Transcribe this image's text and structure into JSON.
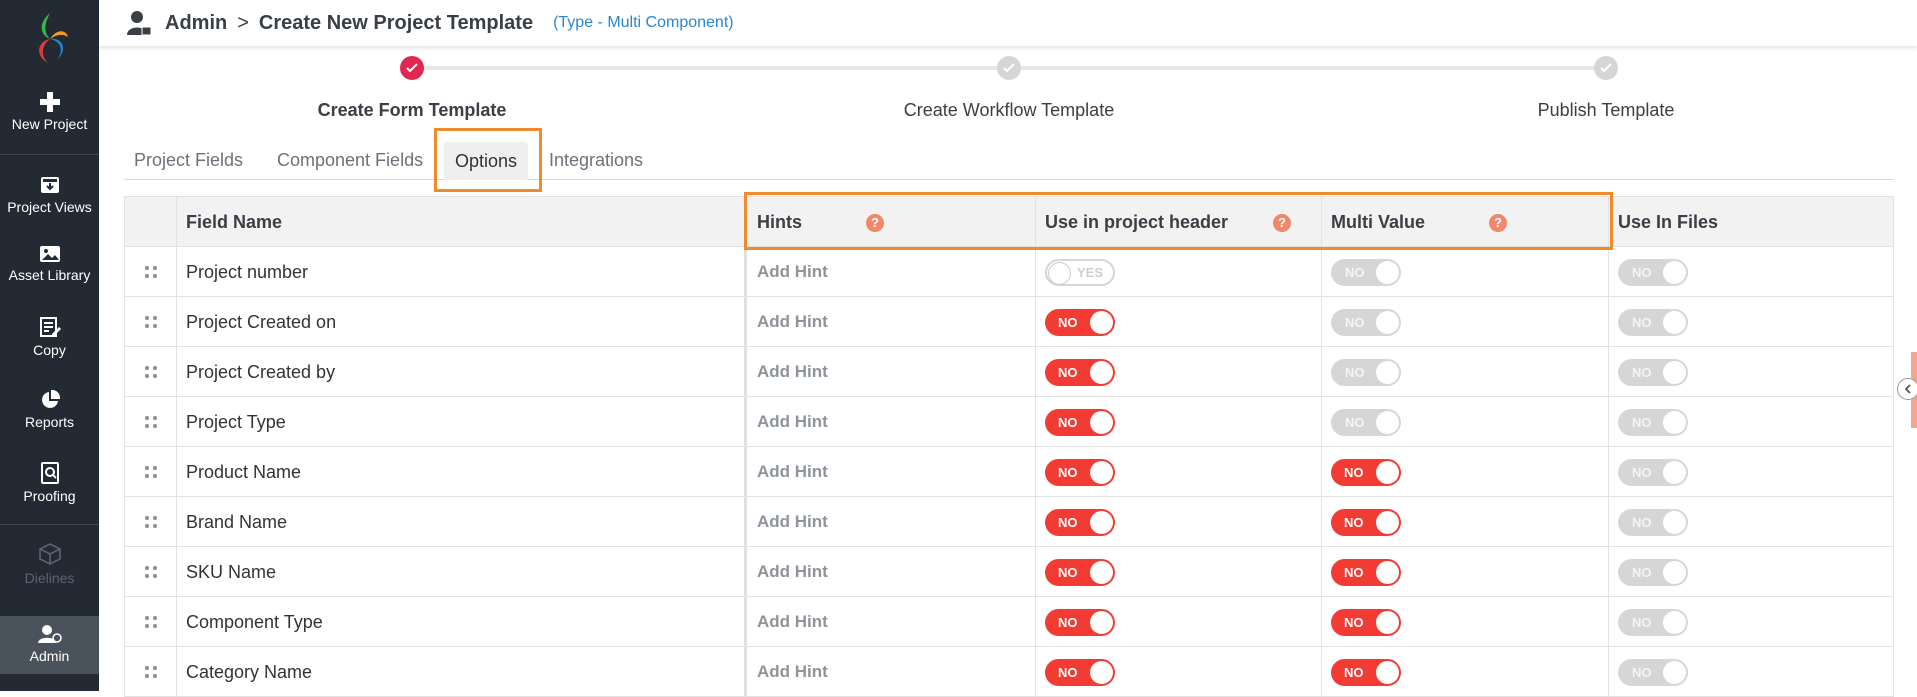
{
  "sidebar": {
    "items": [
      {
        "label": "New Project",
        "icon": "plus-icon"
      },
      {
        "label": "Project Views",
        "icon": "project-views-icon"
      },
      {
        "label": "Asset Library",
        "icon": "image-icon"
      },
      {
        "label": "Copy",
        "icon": "edit-icon"
      },
      {
        "label": "Reports",
        "icon": "pie-chart-icon"
      },
      {
        "label": "Proofing",
        "icon": "proofing-icon"
      },
      {
        "label": "Dielines",
        "icon": "box-icon"
      },
      {
        "label": "Admin",
        "icon": "admin-user-icon"
      }
    ]
  },
  "header": {
    "breadcrumb_root": "Admin",
    "separator": ">",
    "page_title": "Create New Project Template",
    "subtitle": "(Type - Multi Component)"
  },
  "stepper": {
    "steps": [
      {
        "label": "Create Form Template",
        "state": "complete"
      },
      {
        "label": "Create Workflow Template",
        "state": "pending"
      },
      {
        "label": "Publish Template",
        "state": "pending"
      }
    ]
  },
  "tabs": [
    {
      "label": "Project Fields"
    },
    {
      "label": "Component Fields"
    },
    {
      "label": "Options",
      "active": true
    },
    {
      "label": "Integrations"
    }
  ],
  "table": {
    "columns": {
      "field_name": "Field Name",
      "hints": "Hints",
      "use_in_header": "Use in project header",
      "multi_value": "Multi Value",
      "use_in_files": "Use In Files"
    },
    "rows": [
      {
        "name": "Project number",
        "hint": "Add Hint",
        "header": "YES",
        "header_state": "off",
        "multi": "NO",
        "multi_state": "disabled",
        "files": "NO",
        "files_state": "disabled"
      },
      {
        "name": "Project Created on",
        "hint": "Add Hint",
        "header": "NO",
        "header_state": "on",
        "multi": "NO",
        "multi_state": "disabled",
        "files": "NO",
        "files_state": "disabled"
      },
      {
        "name": "Project Created by",
        "hint": "Add Hint",
        "header": "NO",
        "header_state": "on",
        "multi": "NO",
        "multi_state": "disabled",
        "files": "NO",
        "files_state": "disabled"
      },
      {
        "name": "Project Type",
        "hint": "Add Hint",
        "header": "NO",
        "header_state": "on",
        "multi": "NO",
        "multi_state": "disabled",
        "files": "NO",
        "files_state": "disabled"
      },
      {
        "name": "Product Name",
        "hint": "Add Hint",
        "header": "NO",
        "header_state": "on",
        "multi": "NO",
        "multi_state": "on",
        "files": "NO",
        "files_state": "disabled"
      },
      {
        "name": "Brand Name",
        "hint": "Add Hint",
        "header": "NO",
        "header_state": "on",
        "multi": "NO",
        "multi_state": "on",
        "files": "NO",
        "files_state": "disabled"
      },
      {
        "name": "SKU Name",
        "hint": "Add Hint",
        "header": "NO",
        "header_state": "on",
        "multi": "NO",
        "multi_state": "on",
        "files": "NO",
        "files_state": "disabled"
      },
      {
        "name": "Component Type",
        "hint": "Add Hint",
        "header": "NO",
        "header_state": "on",
        "multi": "NO",
        "multi_state": "on",
        "files": "NO",
        "files_state": "disabled"
      },
      {
        "name": "Category Name",
        "hint": "Add Hint",
        "header": "NO",
        "header_state": "on",
        "multi": "NO",
        "multi_state": "on",
        "files": "NO",
        "files_state": "disabled"
      }
    ]
  },
  "colors": {
    "sidebar_bg": "#232a33",
    "toggle_on": "#f23b33",
    "toggle_disabled": "#d6d6d6",
    "highlight": "#f08a2c",
    "help_badge": "#f2876a",
    "step_complete": "#e0284f",
    "link": "#2a87d0"
  }
}
